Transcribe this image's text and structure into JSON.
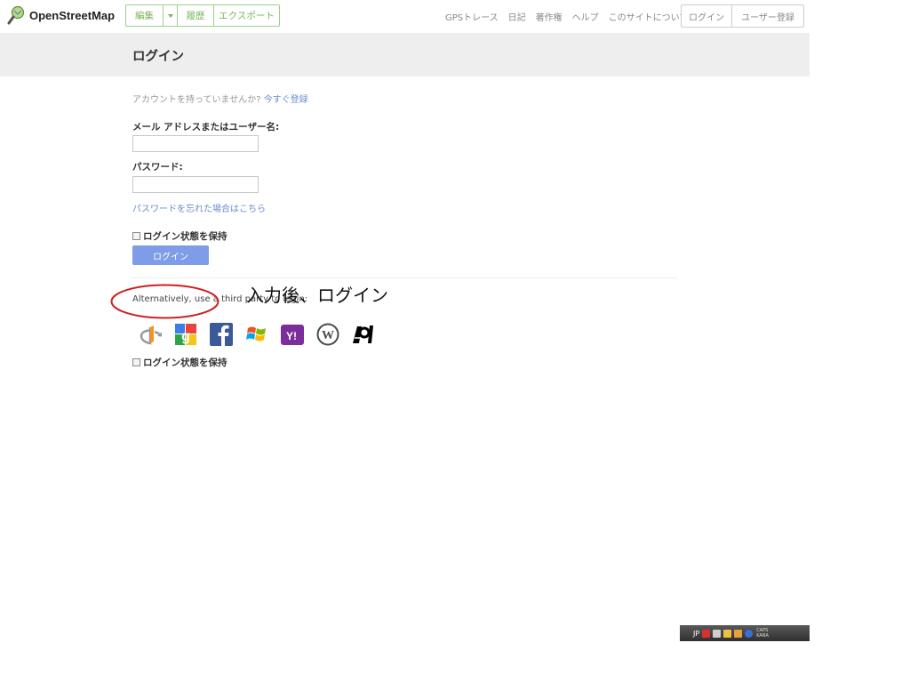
{
  "brand": {
    "name": "OpenStreetMap"
  },
  "toolbar": {
    "edit": "編集",
    "history": "履歴",
    "export": "エクスポート"
  },
  "nav": {
    "items": [
      "GPSトレース",
      "日記",
      "著作権",
      "ヘルプ",
      "このサイトについて"
    ]
  },
  "auth": {
    "login": "ログイン",
    "signup": "ユーザー登録"
  },
  "page": {
    "title": "ログイン"
  },
  "form": {
    "no_account": "アカウントを持っていませんか? ",
    "signup_now": "今すぐ登録",
    "email_label": "メール アドレスまたはユーザー名:",
    "email_value": "",
    "password_label": "パスワード:",
    "password_value": "",
    "forgot": "パスワードを忘れた場合はこちら",
    "remember": "ログイン状態を保持",
    "remember_checked": false,
    "submit": "ログイン"
  },
  "alt": {
    "text": "Alternatively, use a third party to login:",
    "remember": "ログイン状態を保持",
    "providers": [
      "openid-icon",
      "google-icon",
      "facebook-icon",
      "windows-live-icon",
      "yahoo-icon",
      "wordpress-icon",
      "aol-icon"
    ]
  },
  "annotation": {
    "text": "入力後、ログイン"
  },
  "taskbar": {
    "lang": "JP",
    "small_top": "CAPS",
    "small_bottom": "KANA"
  },
  "colors": {
    "edit_green": "#7ab55c",
    "link_blue": "#6a8dd0",
    "button_blue": "#7e9ce8",
    "header_band": "#eeeeee",
    "annotation_red": "#cc2222"
  }
}
